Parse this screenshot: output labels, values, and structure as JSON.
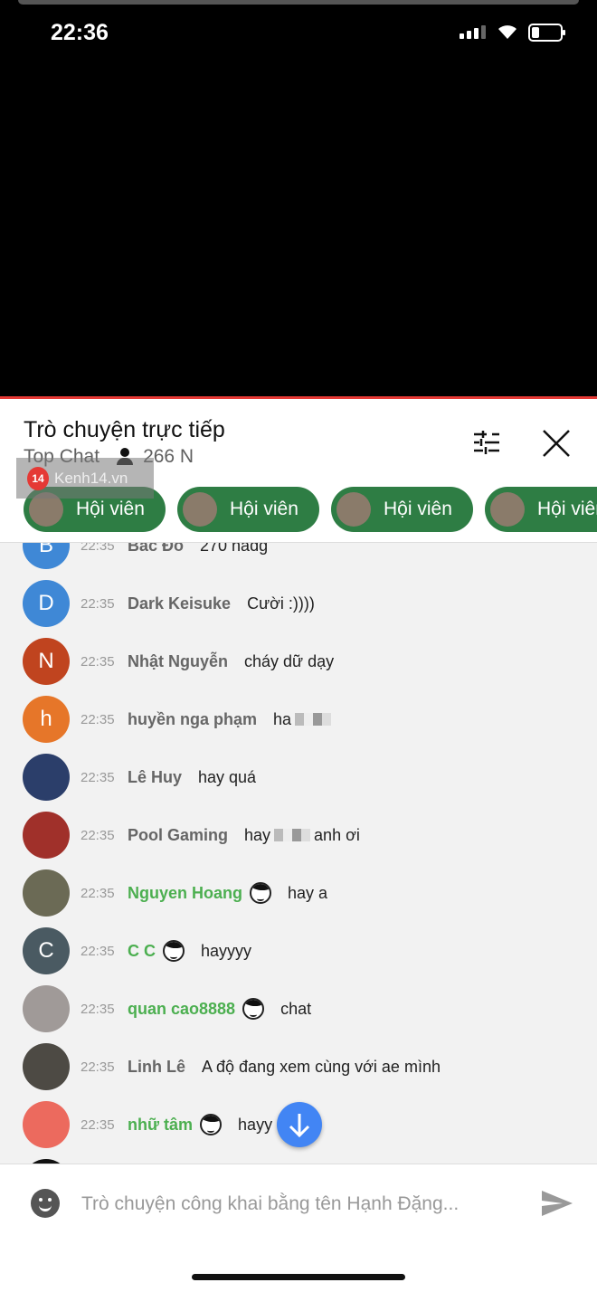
{
  "status_bar": {
    "time": "22:36"
  },
  "header": {
    "title": "Trò chuyện trực tiếp",
    "mode": "Top Chat",
    "viewers": "266 N",
    "watermark": "Kenh14.vn",
    "watermark_logo": "14"
  },
  "chips": [
    {
      "label": "Hội viên"
    },
    {
      "label": "Hội viên"
    },
    {
      "label": "Hội viên"
    },
    {
      "label": "Hội viên"
    }
  ],
  "colors": {
    "member_chip": "#2e7d44",
    "member_name": "#4caf50",
    "fab": "#4285f4",
    "progress": "#e53935"
  },
  "messages": [
    {
      "initial": "B",
      "color": "#3f88d6",
      "time": "22:35",
      "name": "Bác Đô",
      "text": "270 nadg",
      "member": false
    },
    {
      "initial": "D",
      "color": "#3f88d6",
      "time": "22:35",
      "name": "Dark Keisuke",
      "text": "Cười :))))",
      "member": false
    },
    {
      "initial": "N",
      "color": "#c0441f",
      "time": "22:35",
      "name": "Nhật Nguyễn",
      "text": "cháy dữ dạy",
      "member": false
    },
    {
      "initial": "h",
      "color": "#e67629",
      "time": "22:35",
      "name": "huyền nga phạm",
      "text": "ha",
      "blur": true,
      "member": false
    },
    {
      "initial": "",
      "color": "#2b3e6a",
      "time": "22:35",
      "name": "Lê Huy",
      "text": "hay quá",
      "member": false
    },
    {
      "initial": "",
      "color": "#a0302a",
      "time": "22:35",
      "name": "Pool Gaming",
      "text": "hay",
      "blur": true,
      "text_after": "anh ơi",
      "member": false
    },
    {
      "initial": "",
      "color": "#6b6a55",
      "time": "22:35",
      "name": "Nguyen Hoang",
      "text": "hay a",
      "member": true
    },
    {
      "initial": "C",
      "color": "#4a5a62",
      "time": "22:35",
      "name": "C C",
      "text": "hayyyy",
      "member": true
    },
    {
      "initial": "",
      "color": "#a09a98",
      "time": "22:35",
      "name": "quan cao8888",
      "text": "chat",
      "member": true
    },
    {
      "initial": "",
      "color": "#4d4a44",
      "time": "22:35",
      "name": "Linh Lê",
      "text": "A độ đang xem cùng với ae mình",
      "member": false
    },
    {
      "initial": "",
      "color": "#ec6a5e",
      "time": "22:35",
      "name": "nhữ tâm",
      "text": "hayy",
      "member": true
    },
    {
      "initial": "",
      "color": "#111111",
      "time": "",
      "name": "",
      "text": "",
      "member": false
    }
  ],
  "input": {
    "placeholder": "Trò chuyện công khai bằng tên Hạnh Đặng..."
  }
}
